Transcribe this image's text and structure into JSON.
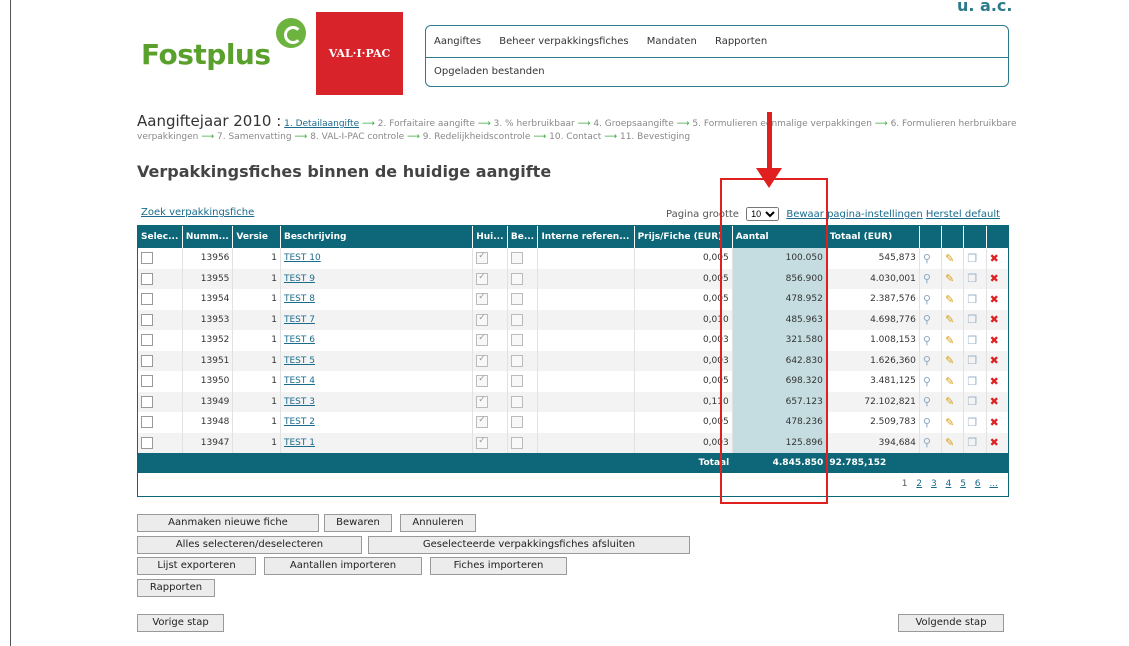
{
  "header": {
    "logo_text": "Fostplus",
    "partner_logo_text": "VAL·I·PAC",
    "cut_off_text": "u. a.c.",
    "nav_items": [
      "Aangiftes",
      "Beheer verpakkingsfiches",
      "Mandaten",
      "Rapporten"
    ],
    "sub_nav": "Opgeladen bestanden"
  },
  "steps": {
    "year_label": "Aangiftejaar 2010 :",
    "current": "1. Detailaangifte",
    "items": [
      "2. Forfaitaire aangifte",
      "3. % herbruikbaar",
      "4. Groepsaangifte",
      "5. Formulieren eenmalige verpakkingen",
      "6. Formulieren herbruikbare verpakkingen",
      "7. Samenvatting",
      "8. VAL-I-PAC controle",
      "9. Redelijkheidscontrole",
      "10. Contact",
      "11. Bevestiging"
    ]
  },
  "page_title": "Verpakkingsfiches binnen de huidige aangifte",
  "toolbar": {
    "search_link": "Zoek verpakkingsfiche",
    "page_size_label": "Pagina grootte",
    "page_size_value": "10",
    "save_settings": "Bewaar pagina-instellingen",
    "reset_default": "Herstel default"
  },
  "table": {
    "columns": [
      "Selec...",
      "Numm...",
      "Versie",
      "Beschrijving",
      "Hui...",
      "Be...",
      "Interne referen...",
      "Prijs/Fiche (EUR)",
      "Aantal",
      "Totaal (EUR)"
    ],
    "rows": [
      {
        "nummer": "13956",
        "versie": "1",
        "beschrijving": "TEST 10",
        "prijs": "0,005",
        "aantal": "100.050",
        "totaal": "545,873"
      },
      {
        "nummer": "13955",
        "versie": "1",
        "beschrijving": "TEST 9",
        "prijs": "0,005",
        "aantal": "856.900",
        "totaal": "4.030,001"
      },
      {
        "nummer": "13954",
        "versie": "1",
        "beschrijving": "TEST 8",
        "prijs": "0,005",
        "aantal": "478.952",
        "totaal": "2.387,576"
      },
      {
        "nummer": "13953",
        "versie": "1",
        "beschrijving": "TEST 7",
        "prijs": "0,010",
        "aantal": "485.963",
        "totaal": "4.698,776"
      },
      {
        "nummer": "13952",
        "versie": "1",
        "beschrijving": "TEST 6",
        "prijs": "0,003",
        "aantal": "321.580",
        "totaal": "1.008,153"
      },
      {
        "nummer": "13951",
        "versie": "1",
        "beschrijving": "TEST 5",
        "prijs": "0,003",
        "aantal": "642.830",
        "totaal": "1.626,360"
      },
      {
        "nummer": "13950",
        "versie": "1",
        "beschrijving": "TEST 4",
        "prijs": "0,005",
        "aantal": "698.320",
        "totaal": "3.481,125"
      },
      {
        "nummer": "13949",
        "versie": "1",
        "beschrijving": "TEST 3",
        "prijs": "0,110",
        "aantal": "657.123",
        "totaal": "72.102,821"
      },
      {
        "nummer": "13948",
        "versie": "1",
        "beschrijving": "TEST 2",
        "prijs": "0,005",
        "aantal": "478.236",
        "totaal": "2.509,783"
      },
      {
        "nummer": "13947",
        "versie": "1",
        "beschrijving": "TEST 1",
        "prijs": "0,003",
        "aantal": "125.896",
        "totaal": "394,684"
      }
    ],
    "footer": {
      "label": "Totaal",
      "aantal": "4.845.850",
      "totaal": "92.785,152"
    },
    "pages": {
      "current": "1",
      "links": [
        "2",
        "3",
        "4",
        "5",
        "6",
        "..."
      ]
    }
  },
  "buttons": {
    "new_fiche": "Aanmaken nieuwe fiche",
    "save": "Bewaren",
    "cancel": "Annuleren",
    "select_all": "Alles selecteren/deselecteren",
    "close_selected": "Geselecteerde verpakkingsfiches afsluiten",
    "export": "Lijst exporteren",
    "import_amounts": "Aantallen importeren",
    "import_fiches": "Fiches importeren",
    "reports": "Rapporten",
    "prev": "Vorige stap",
    "next": "Volgende stap"
  },
  "colors": {
    "accent": "#0e6778",
    "highlight": "#e0201e",
    "brand_green": "#5aa02c",
    "brand_red": "#d8232a"
  }
}
